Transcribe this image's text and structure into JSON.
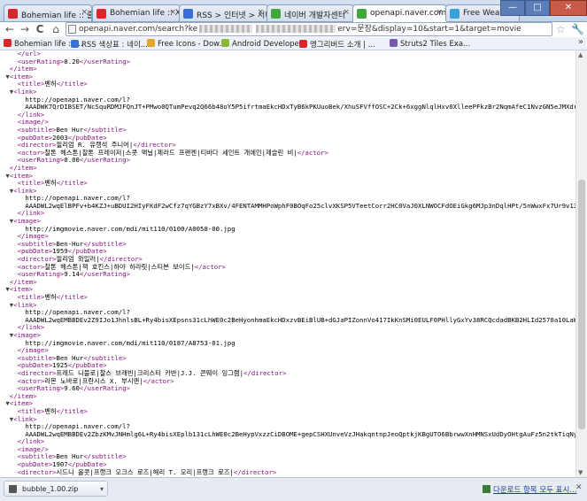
{
  "tabs": [
    {
      "label": "Bohemian life :: 줄쓰",
      "color": "#d9262a"
    },
    {
      "label": "Bohemian life :: Xm",
      "color": "#d9262a"
    },
    {
      "label": "RSS > 인터넷 > 서비",
      "color": "#3b6fd8"
    },
    {
      "label": "네이버 개발자센터",
      "color": "#42a63e"
    },
    {
      "label": "openapi.naver.com/s",
      "color": "#42a63e"
    },
    {
      "label": "Free Weather Icons",
      "color": "#3aa0d8"
    }
  ],
  "window": {
    "minimize": "—",
    "maximize": "□",
    "close": "✕"
  },
  "toolbar": {
    "back": "←",
    "forward": "→",
    "reload": "C",
    "home": "⌂",
    "url_start": "openapi.naver.com/search?ke",
    "url_end": "erv=문장&display=10&start=1&target=movie",
    "star": "☆",
    "wrench": "🔧"
  },
  "bookmarks": [
    {
      "label": "Bohemian life :: ...",
      "color": "#d9262a"
    },
    {
      "label": "RSS 색상표 : 네이...",
      "color": "#3b6fd8"
    },
    {
      "label": "Free Icons - Dow...",
      "color": "#e2a72a"
    },
    {
      "label": "Android Developers",
      "color": "#8ab83a"
    },
    {
      "label": "앵그리버드 소개 | ...",
      "color": "#d9262a"
    },
    {
      "label": "Struts2 Tiles Exa...",
      "color": "#7a58b0"
    }
  ],
  "bookmarks_more": "»",
  "xml_lines": [
    [
      4,
      "tag",
      "</url>"
    ],
    [
      4,
      "mix",
      "<userRating>",
      "8.20",
      "</userRating>"
    ],
    [
      2,
      "tag",
      "</item>"
    ],
    [
      1,
      "tw",
      "▼",
      "tag",
      "<item>"
    ],
    [
      4,
      "mix",
      "<title>",
      "벤허",
      "</title>"
    ],
    [
      2,
      "tw",
      "▼",
      "tag",
      "<link>"
    ],
    [
      6,
      "url",
      "http://openapi.naver.com/l?"
    ],
    [
      6,
      "url",
      "AAADWK7QrDIBSET/NcSquRDMJFQnJT+PMwo0QTumPevq2Q66b48oY5P5ifrtmaEkcHDxTyB6kPKUuoBek/XhuSFVffOSC+2Ck+6xggNlqlHxv0XlleePFkzBr2NqmAfeC1NvzGN5eJMXdr/TUu73X5bNx"
    ],
    [
      4,
      "tag",
      "</link>"
    ],
    [
      4,
      "tag",
      "<image/>"
    ],
    [
      4,
      "mix",
      "<subtitle>",
      "Ben Hur",
      "</subtitle>"
    ],
    [
      4,
      "mix",
      "<pubDate>",
      "2003",
      "</pubDate>"
    ],
    [
      4,
      "mix",
      "<director>",
      "윌리엄 R. 유랭석 주니어|",
      "</director>"
    ],
    [
      4,
      "mix",
      "<actor>",
      "찰톤 헤스톤|찰톤 프레이저|스콧 맥닐|제라드 프랜켄|티바다 세인트 개에인|제슬린 비|",
      "</actor>"
    ],
    [
      4,
      "mix",
      "<userRating>",
      "0.00",
      "</userRating>"
    ],
    [
      2,
      "tag",
      "</item>"
    ],
    [
      1,
      "tw",
      "▼",
      "tag",
      "<item>"
    ],
    [
      4,
      "mix",
      "<title>",
      "벤허",
      "</title>"
    ],
    [
      2,
      "tw",
      "▼",
      "tag",
      "<link>"
    ],
    [
      6,
      "url",
      "http://openapi.naver.com/l?"
    ],
    [
      6,
      "url",
      "AAADWL2wqElBPFv+b4KZJ+uBDUI2HIyFKdF2wCfz7qYGBzY7xBXv/4FENTAMMHPoWphF0BOqFo25clvXKSP5VTeetCorr2HC0VaJ0XLNWOCFdOEiGkg6MJp3nDqlHPt/5nWwxFx7Ur9v13HT5QU85+80"
    ],
    [
      4,
      "tag",
      "</link>"
    ],
    [
      2,
      "tw",
      "▼",
      "tag",
      "<image>"
    ],
    [
      6,
      "url",
      "http://imgmovie.naver.com/mdi/mit110/0100/A0058-00.jpg"
    ],
    [
      4,
      "tag",
      "</image>"
    ],
    [
      4,
      "mix",
      "<subtitle>",
      "Ben-Hur",
      "</subtitle>"
    ],
    [
      4,
      "mix",
      "<pubDate>",
      "1959",
      "</pubDate>"
    ],
    [
      4,
      "mix",
      "<director>",
      "윌리엄 와일러|",
      "</director>"
    ],
    [
      4,
      "mix",
      "<actor>",
      "찰톤 헤스톤|잭 호킨스|하야 하라릿|스티븐 보이드|",
      "</actor>"
    ],
    [
      4,
      "mix",
      "<userRating>",
      "9.14",
      "</userRating>"
    ],
    [
      2,
      "tag",
      "</item>"
    ],
    [
      1,
      "tw",
      "▼",
      "tag",
      "<item>"
    ],
    [
      4,
      "mix",
      "<title>",
      "벤허",
      "</title>"
    ],
    [
      2,
      "tw",
      "▼",
      "tag",
      "<link>"
    ],
    [
      6,
      "url",
      "http://openapi.naver.com/l?"
    ],
    [
      6,
      "url",
      "AAADWL2wqEMBBDEv2Z9IJo1JhnlsBL+Ry4bisXEpsns31cLhWE0c2BeHyonhmaEkcHDxzvBEiBlUB+dGJaPIZonnVo417IkKnSMi0EULF0PHllyGxYv38RCQcdadBKB2HLId2570a10LaW/c98u97jLav"
    ],
    [
      4,
      "tag",
      "</link>"
    ],
    [
      2,
      "tw",
      "▼",
      "tag",
      "<image>"
    ],
    [
      6,
      "url",
      "http://imgmovie.naver.com/mdi/mit110/0187/A8753-01.jpg"
    ],
    [
      4,
      "tag",
      "</image>"
    ],
    [
      4,
      "mix",
      "<subtitle>",
      "Ben Hur",
      "</subtitle>"
    ],
    [
      4,
      "mix",
      "<pubDate>",
      "1925",
      "</pubDate>"
    ],
    [
      4,
      "mix",
      "<director>",
      "프레드 니블로|찰스 브래빈|크리스티 카반|J.J. 콘웨이 잉그램|",
      "</director>"
    ],
    [
      4,
      "mix",
      "<actor>",
      "라몬 노바로|프란시스 X. 부시맨|",
      "</actor>"
    ],
    [
      4,
      "mix",
      "<userRating>",
      "9.60",
      "</userRating>"
    ],
    [
      2,
      "tag",
      "</item>"
    ],
    [
      1,
      "tw",
      "▼",
      "tag",
      "<item>"
    ],
    [
      4,
      "mix",
      "<title>",
      "벤허",
      "</title>"
    ],
    [
      2,
      "tw",
      "▼",
      "tag",
      "<link>"
    ],
    [
      6,
      "url",
      "http://openapi.naver.com/l?"
    ],
    [
      6,
      "url",
      "AAADWL2wqEMBBDEv2ZbzKMvJNHmlg6L+Ry4bisXEplb131cLhWE0c2BeHypVxzzCiDBOME+gepCSHXUnveVzJHakqntnpJeoQptkjKBgUTO6BbrwwXnHMNSxUdDyOHtgAuFz5n2tkTiqNy9vtXLTrPe6y5r2"
    ],
    [
      4,
      "tag",
      "</link>"
    ],
    [
      4,
      "tag",
      "<image/>"
    ],
    [
      4,
      "mix",
      "<subtitle>",
      "Ben Hur",
      "</subtitle>"
    ],
    [
      4,
      "mix",
      "<pubDate>",
      "1907",
      "</pubDate>"
    ],
    [
      4,
      "mix",
      "<director>",
      "시드니 올콧|프랭크 오크스 로즈|해리 T. 모리|프랭크 로즈|",
      "</director>"
    ]
  ],
  "download": {
    "filename": "bubble_1.00.zip",
    "dropdown": "▾",
    "show_all": "다운로드 항목 모두 표시...",
    "close": "✕"
  },
  "scroll": {
    "up": "▲",
    "down": "▼"
  }
}
